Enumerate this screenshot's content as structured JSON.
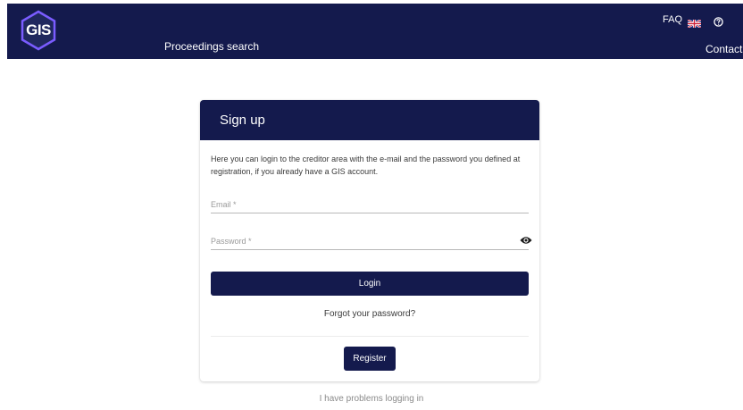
{
  "header": {
    "logo_text": "GIS",
    "proceedings_label": "Proceedings search",
    "faq_label": "FAQ",
    "flag_icon": "uk-flag-icon",
    "help_icon": "help-circle-icon",
    "contact_label": "Contact",
    "background_color": "#141a4d"
  },
  "card": {
    "title": "Sign up",
    "intro": "Here you can login to the creditor area with the e-mail and the password you defined at registration, if you already have a GIS account.",
    "email_label": "Email *",
    "password_label": "Password *",
    "password_toggle_icon": "eye-icon",
    "login_label": "Login",
    "forgot_label": "Forgot your password?",
    "register_label": "Register"
  },
  "footer": {
    "problems_label": "I have problems logging in"
  }
}
